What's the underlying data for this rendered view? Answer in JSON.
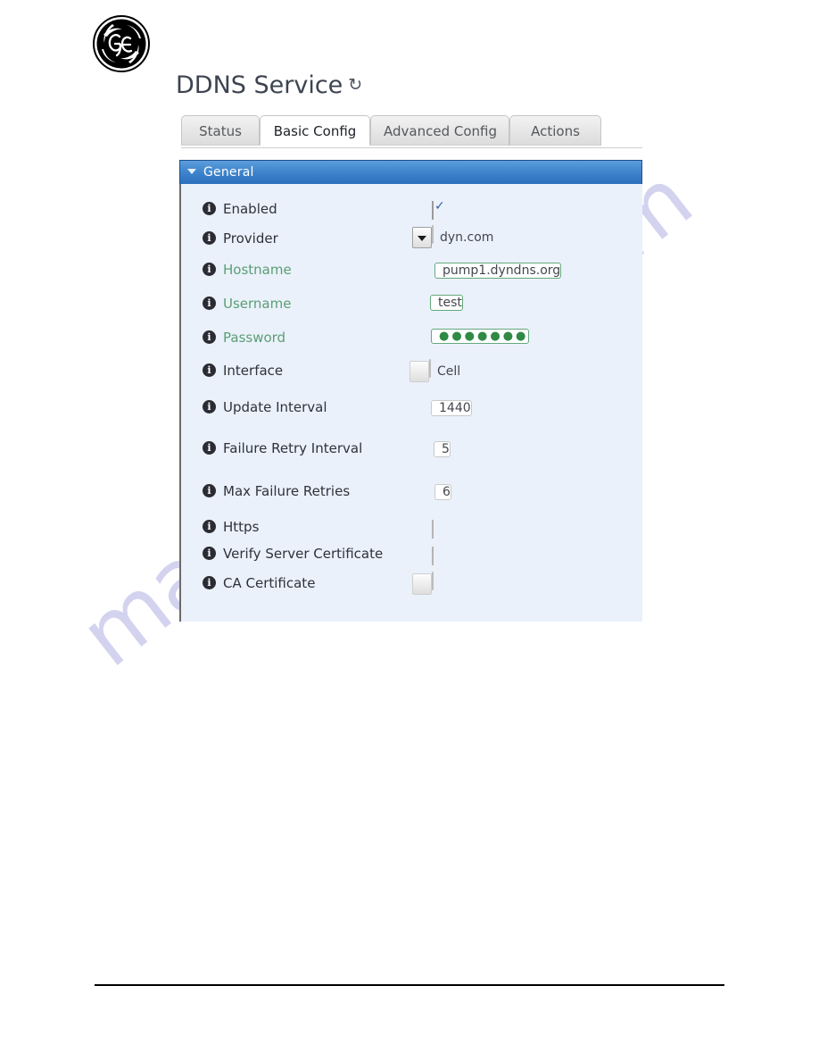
{
  "brand": {
    "logo_name": "ge-monogram-logo"
  },
  "header": {
    "title": "DDNS Service",
    "refresh_icon": "↻"
  },
  "tabs": [
    {
      "id": "status",
      "label": "Status",
      "active": false
    },
    {
      "id": "basic",
      "label": "Basic Config",
      "active": true
    },
    {
      "id": "advanced",
      "label": "Advanced Config",
      "active": false
    },
    {
      "id": "actions",
      "label": "Actions",
      "active": false
    }
  ],
  "panel": {
    "title": "General",
    "collapse_icon": "collapse-triangle",
    "header_color": "#3f85cd",
    "body_color": "#eaf1fb"
  },
  "fields": [
    {
      "label": "Enabled",
      "label_color": "#2e323a",
      "type": "checkbox",
      "value": "checked"
    },
    {
      "label": "Provider",
      "label_color": "#2e323a",
      "type": "select",
      "value": "dyn.com"
    },
    {
      "label": "Hostname",
      "label_color": "#5b9e73",
      "type": "text",
      "value": "pump1.dyndns.org"
    },
    {
      "label": "Username",
      "label_color": "#5b9e73",
      "type": "text",
      "value": "test"
    },
    {
      "label": "Password",
      "label_color": "#5b9e73",
      "type": "password",
      "value": "●●●●●●●"
    },
    {
      "label": "Interface",
      "label_color": "#2e323a",
      "type": "select",
      "value": "Cell"
    },
    {
      "label": "Update Interval",
      "label_color": "#2e323a",
      "type": "text",
      "value": "1440"
    },
    {
      "label": "Failure Retry Interval",
      "label_color": "#2e323a",
      "type": "text",
      "value": "5"
    },
    {
      "label": "Max Failure Retries",
      "label_color": "#2e323a",
      "type": "text",
      "value": "6"
    },
    {
      "label": "Https",
      "label_color": "#2e323a",
      "type": "checkbox",
      "value": "unchecked"
    },
    {
      "label": "Verify Server Certificate",
      "label_color": "#2e323a",
      "type": "checkbox",
      "value": "unchecked"
    },
    {
      "label": "CA Certificate",
      "label_color": "#2e323a",
      "type": "select",
      "value": ""
    }
  ],
  "info_icon_glyph": "i",
  "watermark": {
    "text": "manualshive.com",
    "color": "#b9b9e8"
  }
}
